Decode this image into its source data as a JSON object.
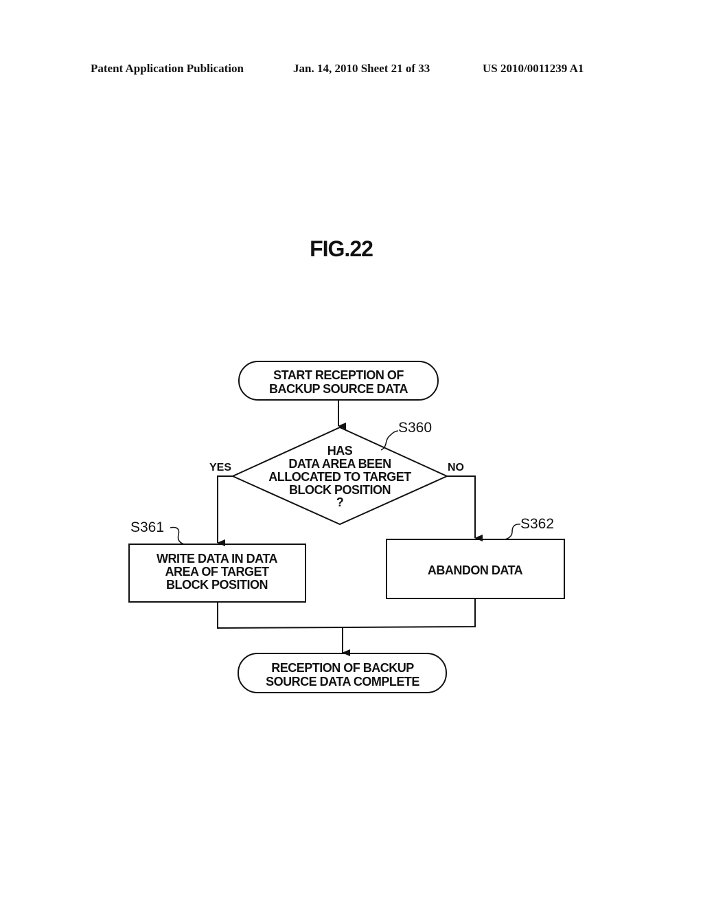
{
  "header": {
    "publication": "Patent Application Publication",
    "date_sheet": "Jan. 14, 2010  Sheet 21 of 33",
    "patent_number": "US 2010/0011239 A1"
  },
  "figure": {
    "title": "FIG.22",
    "nodes": {
      "start": {
        "lines": [
          "START RECEPTION OF",
          "BACKUP SOURCE DATA"
        ]
      },
      "decision": {
        "step": "S360",
        "lines": [
          "HAS",
          "DATA AREA BEEN",
          "ALLOCATED TO TARGET",
          "BLOCK POSITION",
          "?"
        ]
      },
      "write": {
        "step": "S361",
        "lines": [
          "WRITE DATA IN DATA",
          "AREA OF TARGET",
          "BLOCK POSITION"
        ]
      },
      "abandon": {
        "step": "S362",
        "lines": [
          "ABANDON DATA"
        ]
      },
      "end": {
        "lines": [
          "RECEPTION OF BACKUP",
          "SOURCE DATA COMPLETE"
        ]
      }
    },
    "branches": {
      "yes": "YES",
      "no": "NO"
    }
  }
}
